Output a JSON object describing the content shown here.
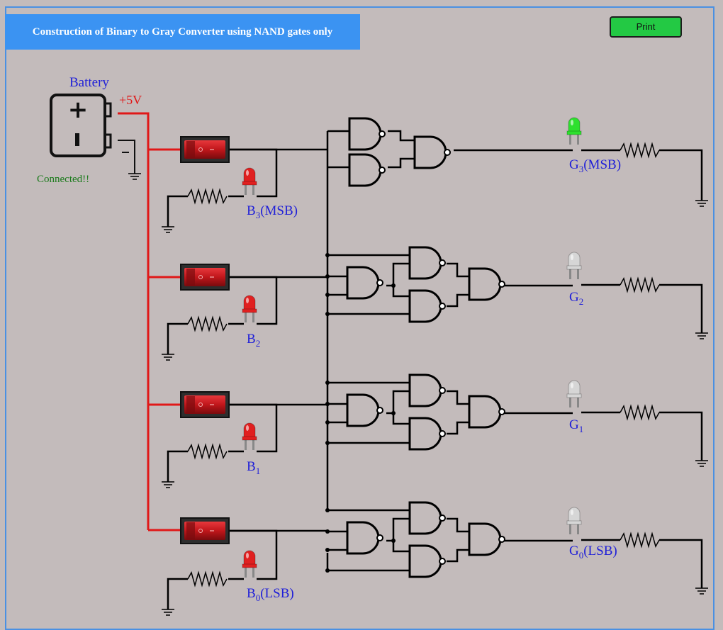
{
  "title": "Construction of Binary to Gray Converter using NAND gates only",
  "print_label": "Print",
  "battery": {
    "label": "Battery",
    "voltage_label": "+5V",
    "status": "Connected!!"
  },
  "inputs": [
    {
      "main": "B",
      "sub": "3",
      "suffix": "(MSB)",
      "switch_on": true,
      "led_on": true
    },
    {
      "main": "B",
      "sub": "2",
      "suffix": "",
      "switch_on": true,
      "led_on": true
    },
    {
      "main": "B",
      "sub": "1",
      "suffix": "",
      "switch_on": true,
      "led_on": true
    },
    {
      "main": "B",
      "sub": "0",
      "suffix": "(LSB)",
      "switch_on": true,
      "led_on": true
    }
  ],
  "outputs": [
    {
      "main": "G",
      "sub": "3",
      "suffix": "(MSB)",
      "led_on": true
    },
    {
      "main": "G",
      "sub": "2",
      "suffix": "",
      "led_on": false
    },
    {
      "main": "G",
      "sub": "1",
      "suffix": "",
      "led_on": false
    },
    {
      "main": "G",
      "sub": "0",
      "suffix": "(LSB)",
      "led_on": false
    }
  ],
  "colors": {
    "wire": "#000000",
    "power_wire": "#e01818",
    "label": "#1f1fd8",
    "status": "#1b7a1b",
    "led_red": "#e02020",
    "led_green": "#2ee02e",
    "led_off": "#d6d6d6",
    "switch": "#c0161b"
  }
}
